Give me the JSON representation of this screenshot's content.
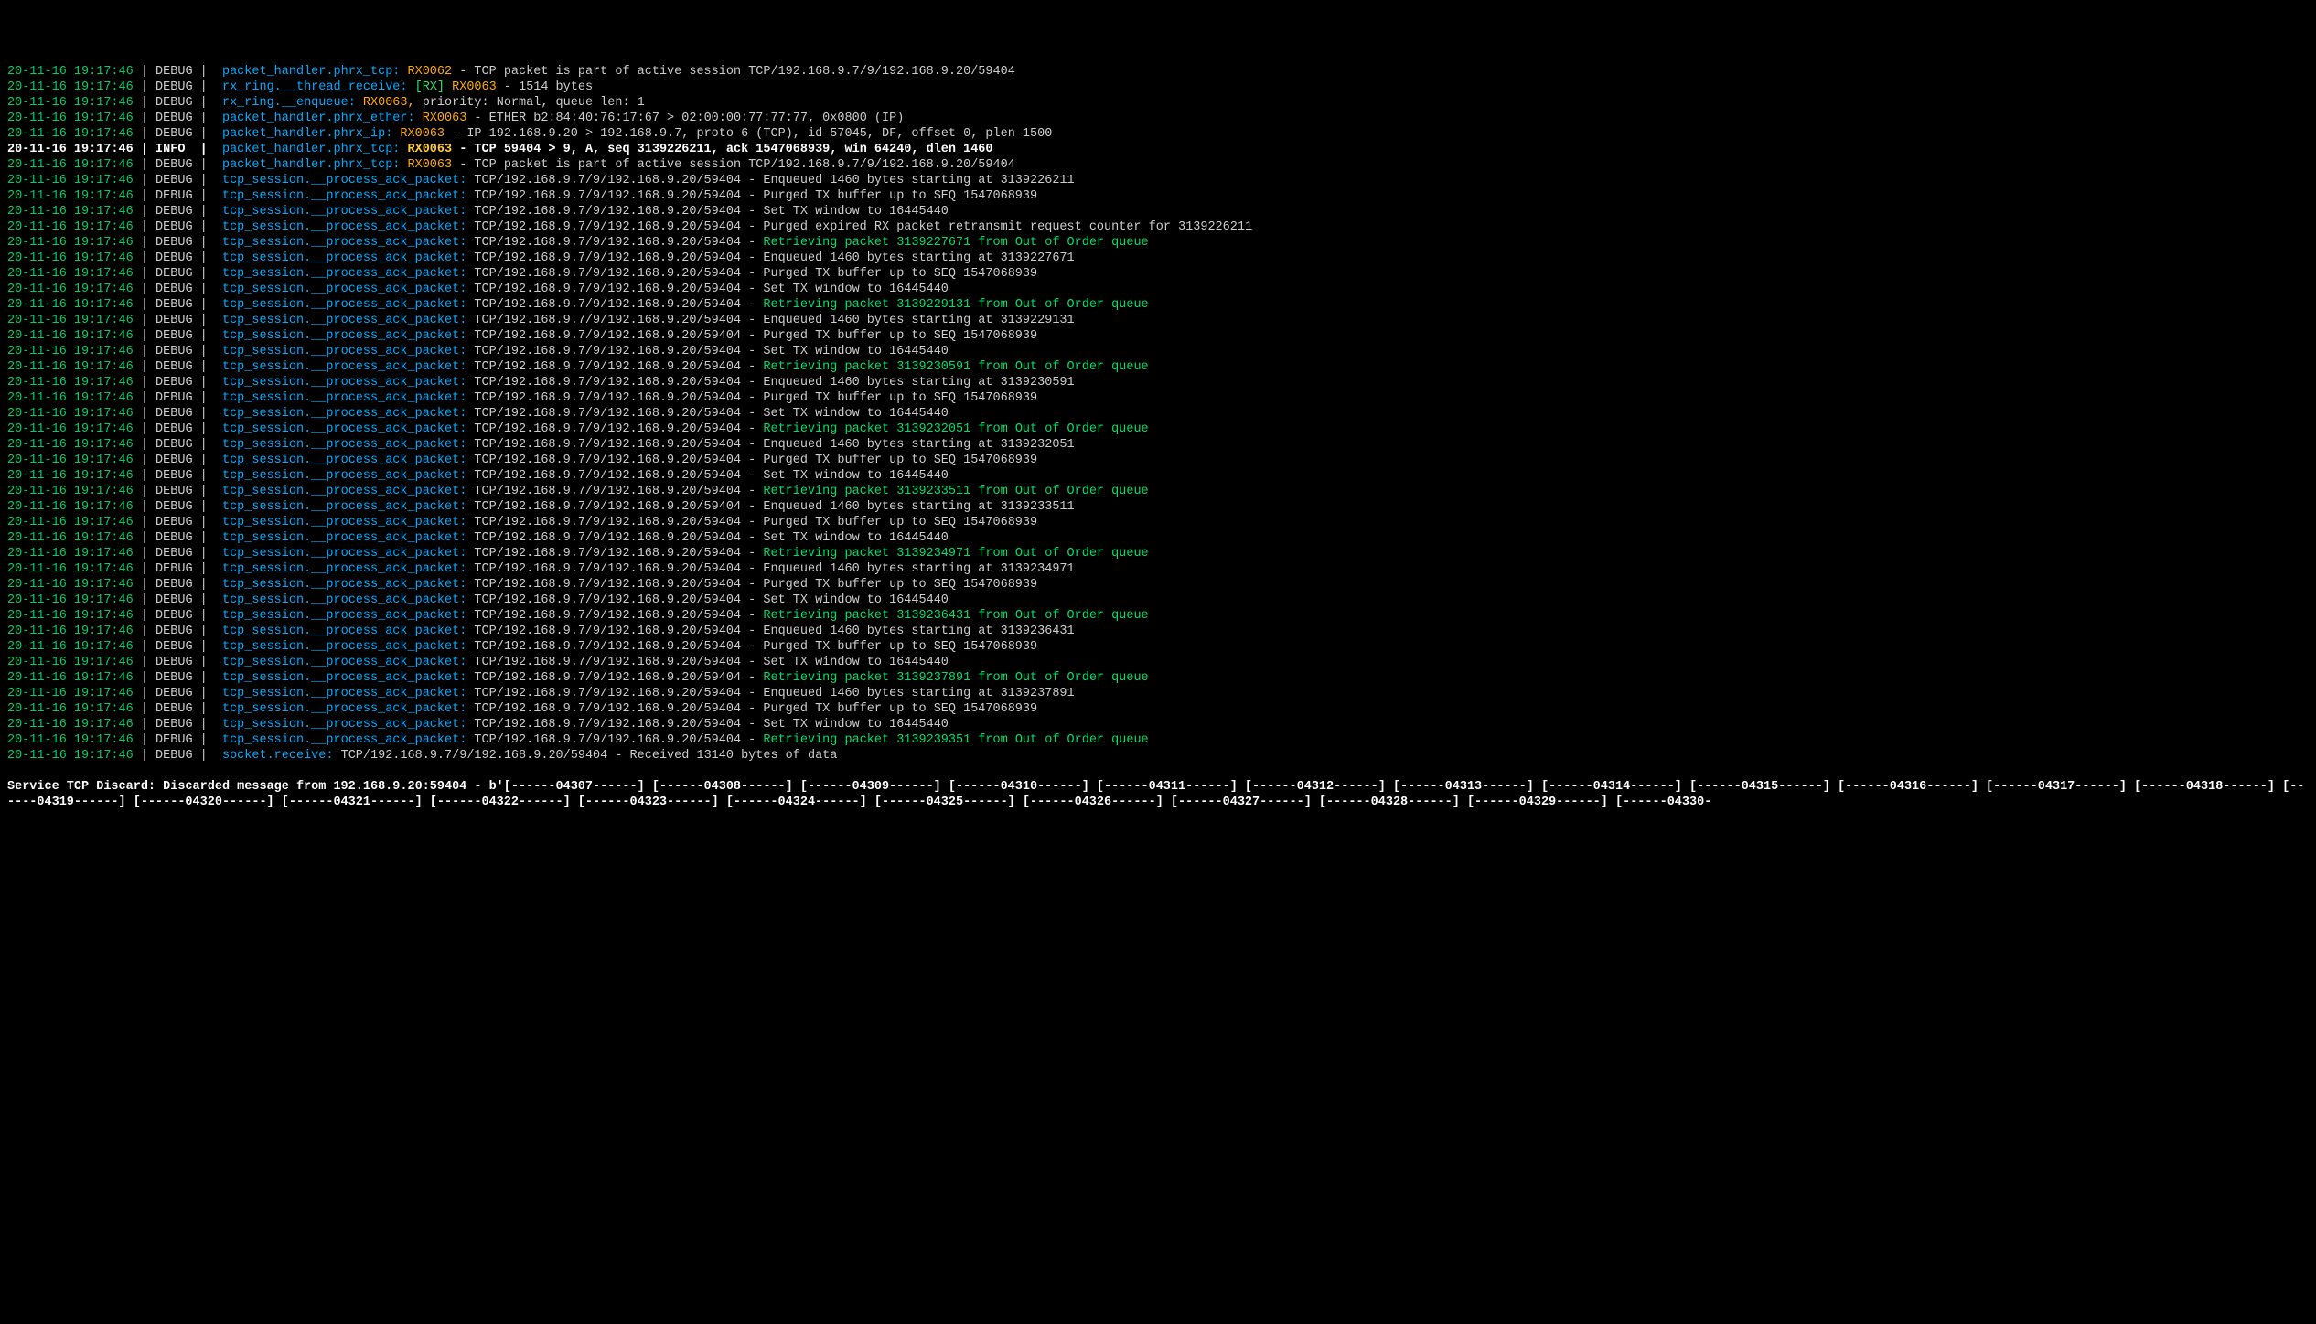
{
  "ts": "20-11-16 19:17:46",
  "sep": " | ",
  "debug": "DEBUG",
  "info": "INFO ",
  "sep2": " |  ",
  "lines": [
    {
      "lvl": "debug",
      "src": "packet_handler.phrx_tcp:",
      "rx": " RX0062 ",
      "msg": "- TCP packet is part of active session TCP/192.168.9.7/9/192.168.9.20/59404"
    },
    {
      "lvl": "debug",
      "src": "rx_ring.__thread_receive:",
      "rxtag": " [RX]",
      "rx": " RX0063 ",
      "msg": "- 1514 bytes"
    },
    {
      "lvl": "debug",
      "src": "rx_ring.__enqueue:",
      "rx": " RX0063, ",
      "msg": "priority: Normal, queue len: 1"
    },
    {
      "lvl": "debug",
      "src": "packet_handler.phrx_ether:",
      "rx": " RX0063 ",
      "msg": "- ETHER b2:84:40:76:17:67 > 02:00:00:77:77:77, 0x0800 (IP)"
    },
    {
      "lvl": "debug",
      "src": "packet_handler.phrx_ip:",
      "rx": " RX0063 ",
      "msg": "- IP 192.168.9.20 > 192.168.9.7, proto 6 (TCP), id 57045, DF, offset 0, plen 1500"
    },
    {
      "lvl": "info",
      "src": "packet_handler.phrx_tcp:",
      "rx": " RX0063 ",
      "msg": "- TCP 59404 > 9, A, seq 3139226211, ack 1547068939, win 64240, dlen 1460"
    },
    {
      "lvl": "debug",
      "src": "packet_handler.phrx_tcp:",
      "rx": " RX0063 ",
      "msg": "- TCP packet is part of active session TCP/192.168.9.7/9/192.168.9.20/59404"
    },
    {
      "lvl": "debug",
      "src": "tcp_session.__process_ack_packet:",
      "rx": "",
      "msg": " TCP/192.168.9.7/9/192.168.9.20/59404 - Enqueued 1460 bytes starting at 3139226211"
    },
    {
      "lvl": "debug",
      "src": "tcp_session.__process_ack_packet:",
      "rx": "",
      "msg": " TCP/192.168.9.7/9/192.168.9.20/59404 - Purged TX buffer up to SEQ 1547068939"
    },
    {
      "lvl": "debug",
      "src": "tcp_session.__process_ack_packet:",
      "rx": "",
      "msg": " TCP/192.168.9.7/9/192.168.9.20/59404 - Set TX window to 16445440"
    },
    {
      "lvl": "debug",
      "src": "tcp_session.__process_ack_packet:",
      "rx": "",
      "msg": " TCP/192.168.9.7/9/192.168.9.20/59404 - Purged expired RX packet retransmit request counter for 3139226211"
    },
    {
      "lvl": "debug",
      "src": "tcp_session.__process_ack_packet:",
      "rx": "",
      "msgpre": " TCP/192.168.9.7/9/192.168.9.20/59404 - ",
      "msgg": "Retrieving packet 3139227671 from Out of Order queue"
    },
    {
      "lvl": "debug",
      "src": "tcp_session.__process_ack_packet:",
      "rx": "",
      "msg": " TCP/192.168.9.7/9/192.168.9.20/59404 - Enqueued 1460 bytes starting at 3139227671"
    },
    {
      "lvl": "debug",
      "src": "tcp_session.__process_ack_packet:",
      "rx": "",
      "msg": " TCP/192.168.9.7/9/192.168.9.20/59404 - Purged TX buffer up to SEQ 1547068939"
    },
    {
      "lvl": "debug",
      "src": "tcp_session.__process_ack_packet:",
      "rx": "",
      "msg": " TCP/192.168.9.7/9/192.168.9.20/59404 - Set TX window to 16445440"
    },
    {
      "lvl": "debug",
      "src": "tcp_session.__process_ack_packet:",
      "rx": "",
      "msgpre": " TCP/192.168.9.7/9/192.168.9.20/59404 - ",
      "msgg": "Retrieving packet 3139229131 from Out of Order queue"
    },
    {
      "lvl": "debug",
      "src": "tcp_session.__process_ack_packet:",
      "rx": "",
      "msg": " TCP/192.168.9.7/9/192.168.9.20/59404 - Enqueued 1460 bytes starting at 3139229131"
    },
    {
      "lvl": "debug",
      "src": "tcp_session.__process_ack_packet:",
      "rx": "",
      "msg": " TCP/192.168.9.7/9/192.168.9.20/59404 - Purged TX buffer up to SEQ 1547068939"
    },
    {
      "lvl": "debug",
      "src": "tcp_session.__process_ack_packet:",
      "rx": "",
      "msg": " TCP/192.168.9.7/9/192.168.9.20/59404 - Set TX window to 16445440"
    },
    {
      "lvl": "debug",
      "src": "tcp_session.__process_ack_packet:",
      "rx": "",
      "msgpre": " TCP/192.168.9.7/9/192.168.9.20/59404 - ",
      "msgg": "Retrieving packet 3139230591 from Out of Order queue"
    },
    {
      "lvl": "debug",
      "src": "tcp_session.__process_ack_packet:",
      "rx": "",
      "msg": " TCP/192.168.9.7/9/192.168.9.20/59404 - Enqueued 1460 bytes starting at 3139230591"
    },
    {
      "lvl": "debug",
      "src": "tcp_session.__process_ack_packet:",
      "rx": "",
      "msg": " TCP/192.168.9.7/9/192.168.9.20/59404 - Purged TX buffer up to SEQ 1547068939"
    },
    {
      "lvl": "debug",
      "src": "tcp_session.__process_ack_packet:",
      "rx": "",
      "msg": " TCP/192.168.9.7/9/192.168.9.20/59404 - Set TX window to 16445440"
    },
    {
      "lvl": "debug",
      "src": "tcp_session.__process_ack_packet:",
      "rx": "",
      "msgpre": " TCP/192.168.9.7/9/192.168.9.20/59404 - ",
      "msgg": "Retrieving packet 3139232051 from Out of Order queue"
    },
    {
      "lvl": "debug",
      "src": "tcp_session.__process_ack_packet:",
      "rx": "",
      "msg": " TCP/192.168.9.7/9/192.168.9.20/59404 - Enqueued 1460 bytes starting at 3139232051"
    },
    {
      "lvl": "debug",
      "src": "tcp_session.__process_ack_packet:",
      "rx": "",
      "msg": " TCP/192.168.9.7/9/192.168.9.20/59404 - Purged TX buffer up to SEQ 1547068939"
    },
    {
      "lvl": "debug",
      "src": "tcp_session.__process_ack_packet:",
      "rx": "",
      "msg": " TCP/192.168.9.7/9/192.168.9.20/59404 - Set TX window to 16445440"
    },
    {
      "lvl": "debug",
      "src": "tcp_session.__process_ack_packet:",
      "rx": "",
      "msgpre": " TCP/192.168.9.7/9/192.168.9.20/59404 - ",
      "msgg": "Retrieving packet 3139233511 from Out of Order queue"
    },
    {
      "lvl": "debug",
      "src": "tcp_session.__process_ack_packet:",
      "rx": "",
      "msg": " TCP/192.168.9.7/9/192.168.9.20/59404 - Enqueued 1460 bytes starting at 3139233511"
    },
    {
      "lvl": "debug",
      "src": "tcp_session.__process_ack_packet:",
      "rx": "",
      "msg": " TCP/192.168.9.7/9/192.168.9.20/59404 - Purged TX buffer up to SEQ 1547068939"
    },
    {
      "lvl": "debug",
      "src": "tcp_session.__process_ack_packet:",
      "rx": "",
      "msg": " TCP/192.168.9.7/9/192.168.9.20/59404 - Set TX window to 16445440"
    },
    {
      "lvl": "debug",
      "src": "tcp_session.__process_ack_packet:",
      "rx": "",
      "msgpre": " TCP/192.168.9.7/9/192.168.9.20/59404 - ",
      "msgg": "Retrieving packet 3139234971 from Out of Order queue"
    },
    {
      "lvl": "debug",
      "src": "tcp_session.__process_ack_packet:",
      "rx": "",
      "msg": " TCP/192.168.9.7/9/192.168.9.20/59404 - Enqueued 1460 bytes starting at 3139234971"
    },
    {
      "lvl": "debug",
      "src": "tcp_session.__process_ack_packet:",
      "rx": "",
      "msg": " TCP/192.168.9.7/9/192.168.9.20/59404 - Purged TX buffer up to SEQ 1547068939"
    },
    {
      "lvl": "debug",
      "src": "tcp_session.__process_ack_packet:",
      "rx": "",
      "msg": " TCP/192.168.9.7/9/192.168.9.20/59404 - Set TX window to 16445440"
    },
    {
      "lvl": "debug",
      "src": "tcp_session.__process_ack_packet:",
      "rx": "",
      "msgpre": " TCP/192.168.9.7/9/192.168.9.20/59404 - ",
      "msgg": "Retrieving packet 3139236431 from Out of Order queue"
    },
    {
      "lvl": "debug",
      "src": "tcp_session.__process_ack_packet:",
      "rx": "",
      "msg": " TCP/192.168.9.7/9/192.168.9.20/59404 - Enqueued 1460 bytes starting at 3139236431"
    },
    {
      "lvl": "debug",
      "src": "tcp_session.__process_ack_packet:",
      "rx": "",
      "msg": " TCP/192.168.9.7/9/192.168.9.20/59404 - Purged TX buffer up to SEQ 1547068939"
    },
    {
      "lvl": "debug",
      "src": "tcp_session.__process_ack_packet:",
      "rx": "",
      "msg": " TCP/192.168.9.7/9/192.168.9.20/59404 - Set TX window to 16445440"
    },
    {
      "lvl": "debug",
      "src": "tcp_session.__process_ack_packet:",
      "rx": "",
      "msgpre": " TCP/192.168.9.7/9/192.168.9.20/59404 - ",
      "msgg": "Retrieving packet 3139237891 from Out of Order queue"
    },
    {
      "lvl": "debug",
      "src": "tcp_session.__process_ack_packet:",
      "rx": "",
      "msg": " TCP/192.168.9.7/9/192.168.9.20/59404 - Enqueued 1460 bytes starting at 3139237891"
    },
    {
      "lvl": "debug",
      "src": "tcp_session.__process_ack_packet:",
      "rx": "",
      "msg": " TCP/192.168.9.7/9/192.168.9.20/59404 - Purged TX buffer up to SEQ 1547068939"
    },
    {
      "lvl": "debug",
      "src": "tcp_session.__process_ack_packet:",
      "rx": "",
      "msg": " TCP/192.168.9.7/9/192.168.9.20/59404 - Set TX window to 16445440"
    },
    {
      "lvl": "debug",
      "src": "tcp_session.__process_ack_packet:",
      "rx": "",
      "msgpre": " TCP/192.168.9.7/9/192.168.9.20/59404 - ",
      "msgg": "Retrieving packet 3139239351 from Out of Order queue"
    },
    {
      "lvl": "debug",
      "src": "socket.receive:",
      "rx": "",
      "msg": " TCP/192.168.9.7/9/192.168.9.20/59404 - Received 13140 bytes of data"
    }
  ],
  "footer": "Service TCP Discard: Discarded message from 192.168.9.20:59404 - b'[------04307------] [------04308------] [------04309------] [------04310------] [------04311------] [------04312------] [------04313------] [------04314------] [------04315------] [------04316------] [------04317------] [------04318------] [------04319------] [------04320------] [------04321------] [------04322------] [------04323------] [------04324------] [------04325------] [------04326------] [------04327------] [------04328------] [------04329------] [------04330-"
}
